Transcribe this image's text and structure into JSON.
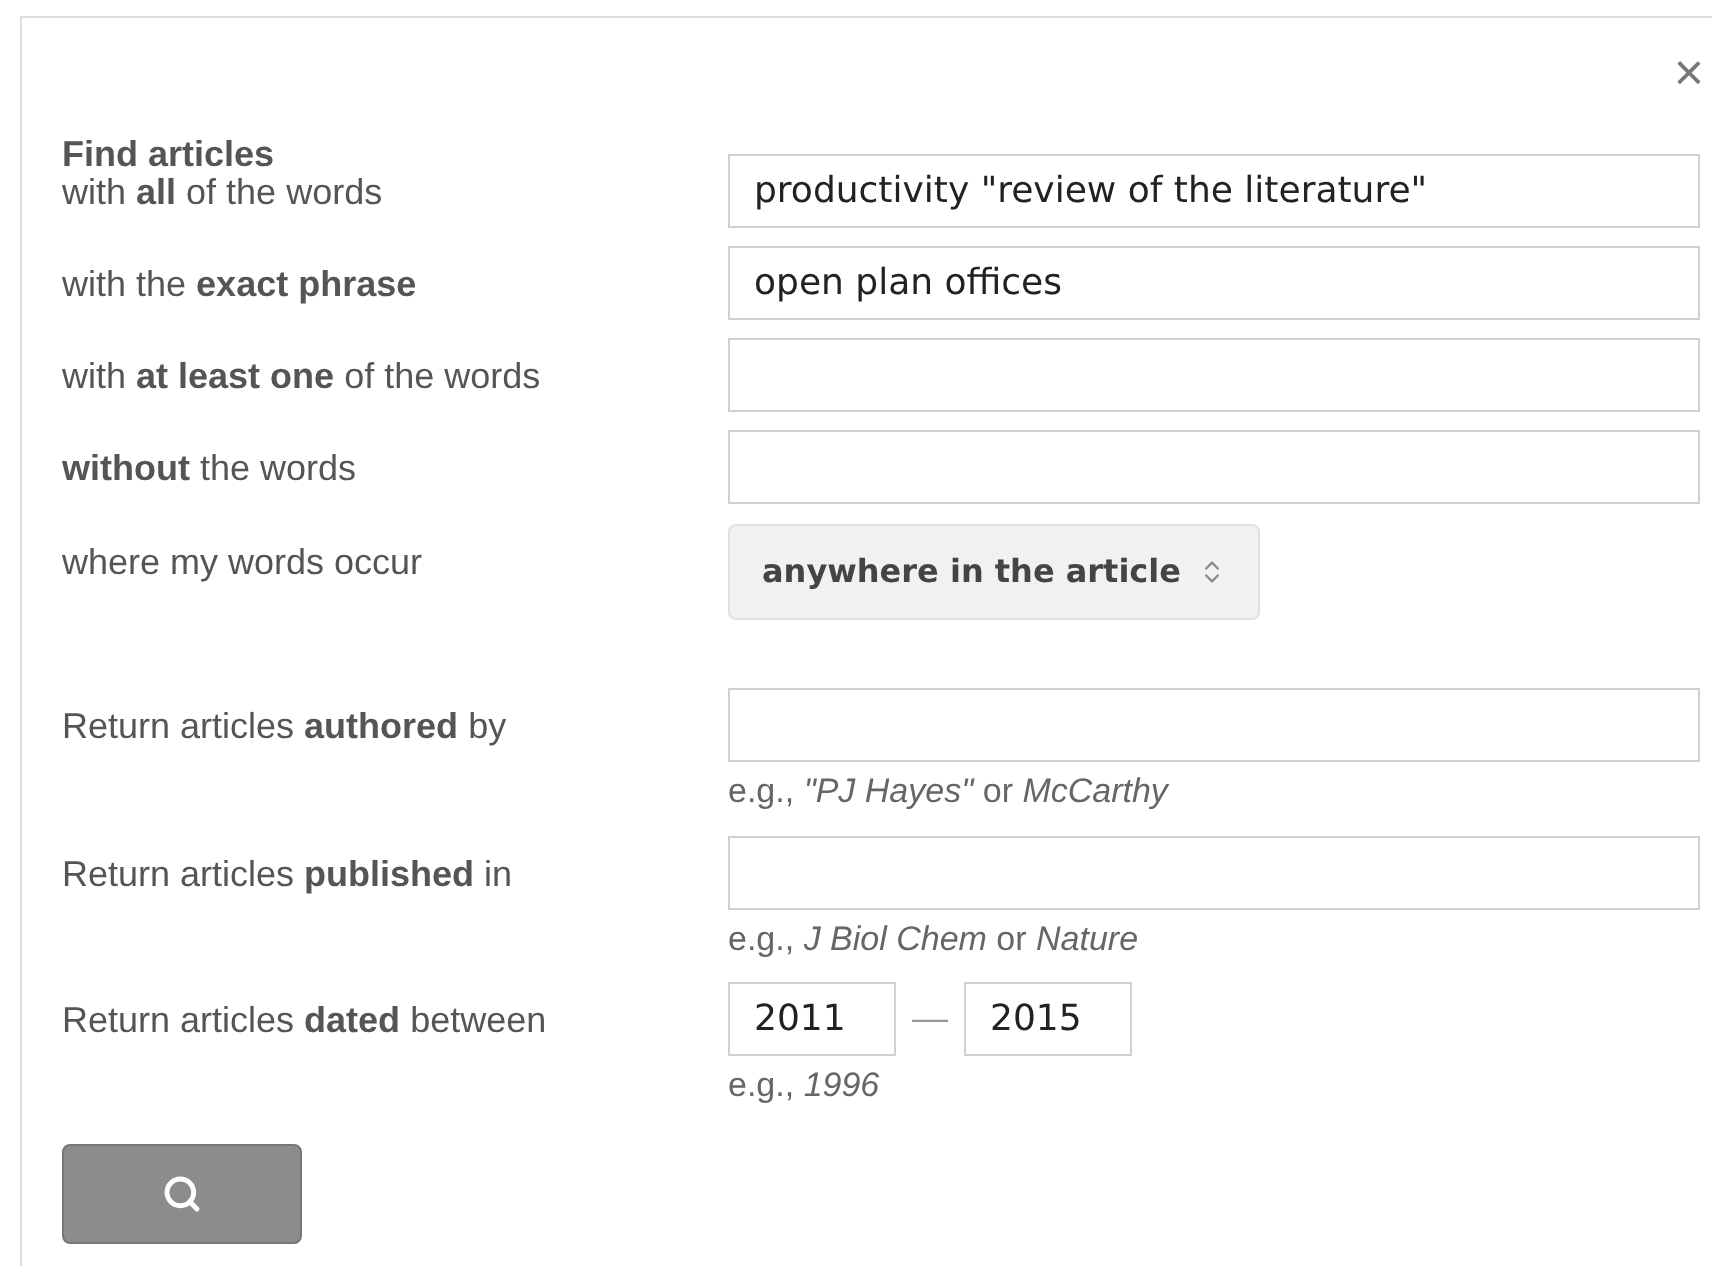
{
  "title": "Find articles",
  "close": "×",
  "fields": [
    {
      "kind": "text",
      "label": "with **all** of the words",
      "value": "productivity \"review of the literature\""
    },
    {
      "kind": "text",
      "label": "with the **exact phrase**",
      "value": "open plan offices"
    },
    {
      "kind": "text",
      "label": "with **at least one** of the words"
    },
    {
      "kind": "text",
      "label": "**without** the words"
    },
    {
      "kind": "select",
      "label": "where my words occur",
      "value": "anywhere in the article"
    },
    {
      "kind": "text",
      "label": "Return articles **authored** by",
      "hint": "e.g., *\"PJ Hayes\"* or *McCarthy*"
    },
    {
      "kind": "text",
      "label": "Return articles **published** in",
      "hint": "e.g., *J Biol Chem* or *Nature*"
    },
    {
      "kind": "range",
      "label": "Return articles **dated** between",
      "from": "2011",
      "separator": "—",
      "to": "2015",
      "hint": "e.g., *1996*"
    }
  ]
}
